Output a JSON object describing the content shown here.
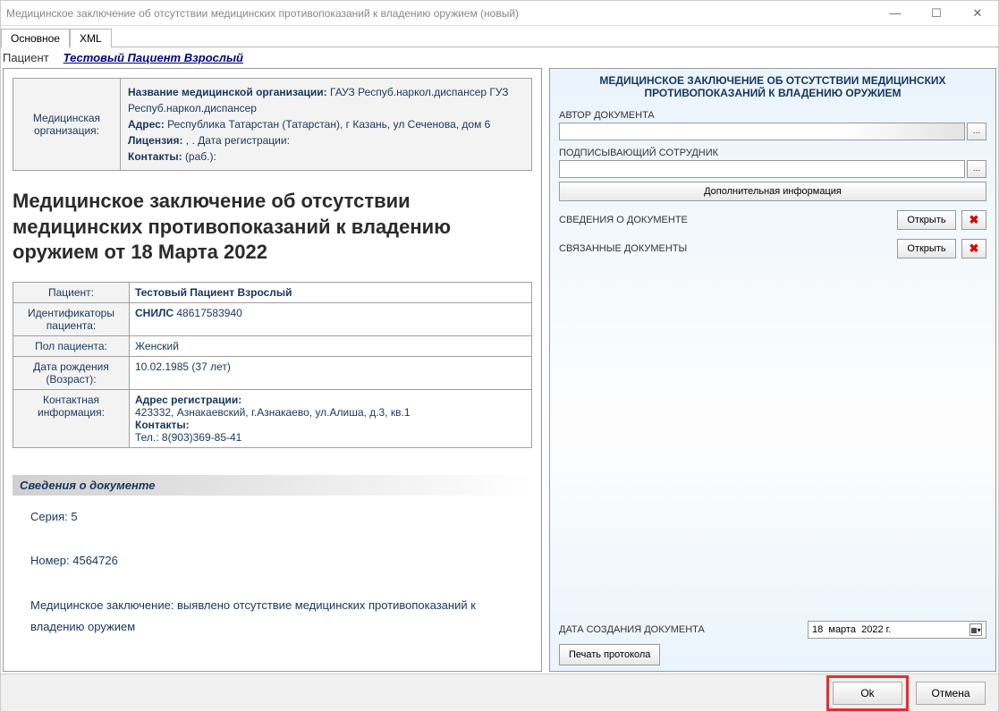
{
  "window": {
    "title": "Медицинское заключение об отсутствии медицинских противопоказаний к владению оружием (новый)"
  },
  "tabs": {
    "main": "Основное",
    "xml": "XML"
  },
  "patient_bar": {
    "label": "Пациент",
    "name": "Тестовый Пациент Взрослый"
  },
  "org": {
    "left_label": "Медицинская организация:",
    "name_label": "Название медицинской организации:",
    "name_value": "ГАУЗ Респуб.наркол.диспансер ГУЗ Респуб.наркол.диспансер",
    "address_label": "Адрес:",
    "address_value": "Республика Татарстан (Татарстан), г Казань, ул Сеченова, дом 6",
    "license_label": "Лицензия:",
    "license_value": ", . Дата регистрации:",
    "contacts_label": "Контакты:",
    "contacts_value": "(раб.):"
  },
  "doc_heading": "Медицинское заключение об отсутствии медицинских противопоказаний к владению оружием от 18 Марта 2022",
  "patient_table": {
    "r1l": "Пациент:",
    "r1v": "Тестовый Пациент Взрослый",
    "r2l": "Идентификаторы пациента:",
    "r2v_bold": "СНИЛС",
    "r2v_rest": " 48617583940",
    "r3l": "Пол пациента:",
    "r3v": "Женский",
    "r4l": "Дата рождения (Возраст):",
    "r4v": "10.02.1985 (37 лет)",
    "r5l": "Контактная информация:",
    "r5_addr_label": "Адрес регистрации:",
    "r5_addr_value": "423332, Азнакаевский, г.Азнакаево, ул.Алиша, д.3, кв.1",
    "r5_cont_label": "Контакты:",
    "r5_tel": "Тел.: 8(903)369-85-41"
  },
  "doc_info": {
    "header": "Сведения о документе",
    "series": "Серия: 5",
    "number": "Номер: 4564726",
    "conclusion": "Медицинское заключение: выявлено отсутствие медицинских противопоказаний к владению оружием"
  },
  "right": {
    "title": "МЕДИЦИНСКОЕ ЗАКЛЮЧЕНИЕ ОБ ОТСУТСТВИИ МЕДИЦИНСКИХ ПРОТИВОПОКАЗАНИЙ К ВЛАДЕНИЮ ОРУЖИЕМ",
    "author_label": "АВТОР ДОКУМЕНТА",
    "signer_label": "ПОДПИСЫВАЮЩИЙ СОТРУДНИК",
    "extra_btn": "Дополнительная информация",
    "doc_info_label": "СВЕДЕНИЯ О ДОКУМЕНТЕ",
    "linked_label": "СВЯЗАННЫЕ ДОКУМЕНТЫ",
    "open_btn": "Открыть",
    "date_label": "ДАТА СОЗДАНИЯ ДОКУМЕНТА",
    "date_day": "18",
    "date_month": "марта",
    "date_year": "2022 г.",
    "print_btn": "Печать протокола"
  },
  "footer": {
    "ok": "Ok",
    "cancel": "Отмена"
  }
}
